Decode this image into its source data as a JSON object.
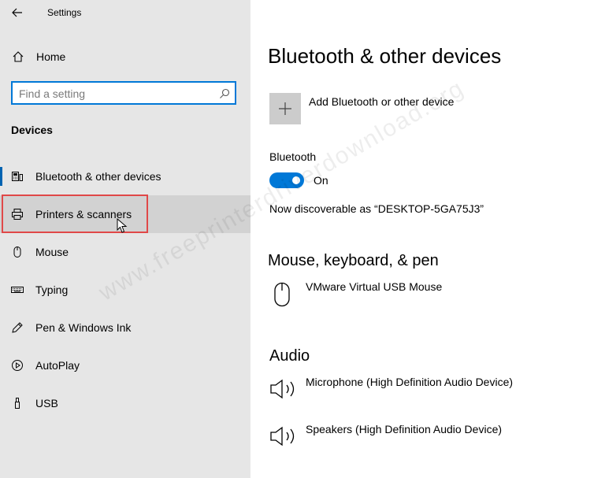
{
  "window": {
    "title": "Settings"
  },
  "sidebar": {
    "home_label": "Home",
    "search_placeholder": "Find a setting",
    "section_title": "Devices",
    "items": [
      {
        "label": "Bluetooth & other devices",
        "icon": "bluetooth-devices-icon",
        "selected": true
      },
      {
        "label": "Printers & scanners",
        "icon": "printer-icon",
        "hovered": true
      },
      {
        "label": "Mouse",
        "icon": "mouse-icon"
      },
      {
        "label": "Typing",
        "icon": "keyboard-icon"
      },
      {
        "label": "Pen & Windows Ink",
        "icon": "pen-icon"
      },
      {
        "label": "AutoPlay",
        "icon": "autoplay-icon"
      },
      {
        "label": "USB",
        "icon": "usb-icon"
      }
    ]
  },
  "main": {
    "title": "Bluetooth & other devices",
    "add_device_label": "Add Bluetooth or other device",
    "bluetooth": {
      "label": "Bluetooth",
      "state_label": "On",
      "discoverable_text": "Now discoverable as “DESKTOP-5GA75J3”"
    },
    "mouse_section": {
      "title": "Mouse, keyboard, & pen",
      "devices": [
        {
          "name": "VMware Virtual USB Mouse",
          "icon": "mouse-icon"
        }
      ]
    },
    "audio_section": {
      "title": "Audio",
      "devices": [
        {
          "name": "Microphone (High Definition Audio Device)",
          "icon": "speaker-icon"
        },
        {
          "name": "Speakers (High Definition Audio Device)",
          "icon": "speaker-icon"
        }
      ]
    }
  },
  "watermark": "www.freeprinterdriverdownload.org",
  "colors": {
    "accent": "#0078d7",
    "sidebar_bg": "#e6e6e6",
    "hover_bg": "#d2d2d2",
    "highlight": "#e04848"
  }
}
